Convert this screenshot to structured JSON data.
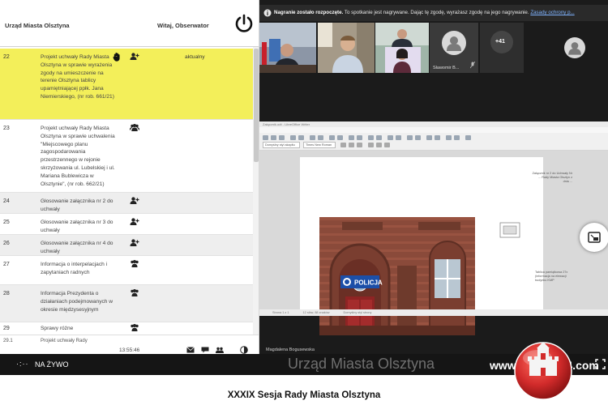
{
  "left_panel": {
    "title": "Urząd Miasta Olsztyna",
    "welcome": "Witaj, Obserwator",
    "rows": [
      {
        "num": "22",
        "desc": "Projekt uchwały Rady Miasta Olsztyna w sprawie wyrażenia zgody na umieszczenie na terenie Olsztyna tablicy upamiętniającej ppłk. Jana Niemierskiego, (nr rob. 661/21)",
        "status": "aktualny"
      },
      {
        "num": "23",
        "desc": "Projekt uchwały Rady Miasta Olsztyna w sprawie uchwalenia \"Miejscowego planu zagospodarowania przestrzennego w rejonie skrzyżowania ul. Lubelskiej i ul. Mariana Bublewicza w Olsztynie\", (nr rob. 662/21)",
        "status": ""
      },
      {
        "num": "24",
        "desc": "Głosowanie załącznika nr 2 do uchwały",
        "status": ""
      },
      {
        "num": "25",
        "desc": "Głosowanie załącznika nr 3 do uchwały",
        "status": ""
      },
      {
        "num": "26",
        "desc": "Głosowanie załącznika nr 4 do uchwały",
        "status": ""
      },
      {
        "num": "27",
        "desc": "Informacja o interpelacjach i zapytaniach radnych",
        "status": ""
      },
      {
        "num": "28",
        "desc": "Informacja Prezydenta o działaniach podejmowanych w okresie międzysesyjnym",
        "status": ""
      },
      {
        "num": "29",
        "desc": "Sprawy różne",
        "status": ""
      },
      {
        "num": "29.1",
        "desc": "Projekt uchwały Rady",
        "status": ""
      }
    ],
    "footer_time": "13:55:46"
  },
  "meeting": {
    "recording_bold": "Nagranie zostało rozpoczęte.",
    "recording_text": "To spotkanie jest nagrywane. Dając tę zgodę, wyrażasz zgodę na jego nagrywanie.",
    "recording_link": "Zasady ochrony p...",
    "participant_name": "Sławomir B...",
    "more_count": "+41",
    "presenter": "Magdalena Bogusewska",
    "police_sign": "POLICJA",
    "doc_title": "Załącznik.odt - LibreOffice Writer",
    "doc_menu": [
      "Plik",
      "Edycja",
      "Widok",
      "Wstaw",
      "Format",
      "Style",
      "Tabela",
      "Formularz",
      "Narzędzia",
      "Okno",
      "Pomoc"
    ],
    "doc_style": "Domyślny styl akapitu",
    "doc_font": "Times New Roman",
    "doc_note_top": "Załącznik nr 2 do Uchwały Nr ... Rady Miasta Olsztyn z dnia ...",
    "doc_note_side": "Tablica pamiątkowa 27x (informacja na elewacji budynku KMP",
    "doc_status": [
      "Strona 1 z 1",
      "12 słów, 88 znaków",
      "Domyślny styl strony"
    ]
  },
  "live_bar": {
    "dots": "·:··",
    "live_label": "NA ŻYWO",
    "watermark": "Urząd Miasta Olsztyna",
    "brand": "www.Olsztyn24.com"
  },
  "caption": "XXXIX Sesja Rady Miasta Olsztyna",
  "colors": {
    "highlight": "#f3ef5a",
    "odd_row": "#eeeeee",
    "dark_bg": "#1b1b1b",
    "police_blue": "#1c4fa8",
    "brand_red": "#d22b2b"
  }
}
